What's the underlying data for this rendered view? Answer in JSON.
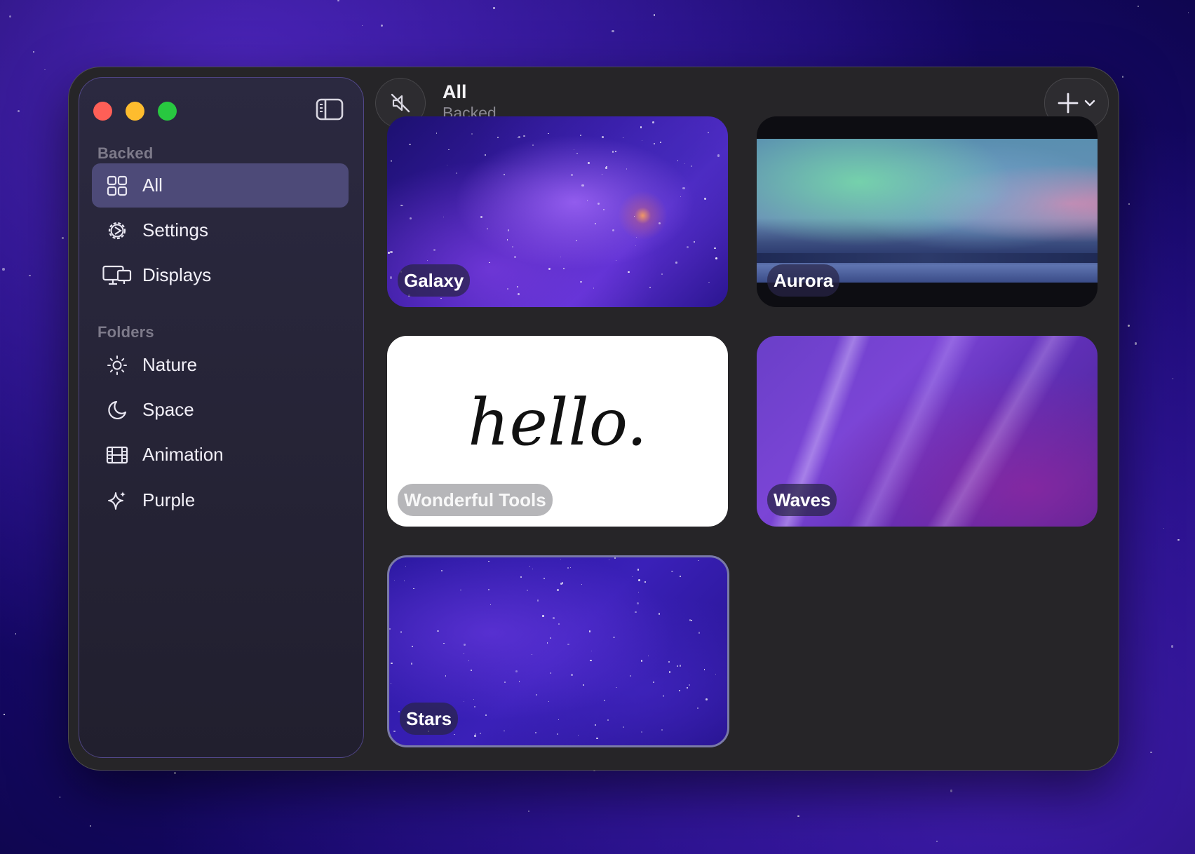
{
  "window": {
    "header": {
      "title": "All",
      "subtitle": "Backed"
    }
  },
  "sidebar": {
    "sections": [
      {
        "title": "Backed",
        "items": [
          {
            "label": "All",
            "icon": "grid-icon",
            "active": true
          },
          {
            "label": "Settings",
            "icon": "gear-icon",
            "active": false
          },
          {
            "label": "Displays",
            "icon": "displays-icon",
            "active": false
          }
        ]
      },
      {
        "title": "Folders",
        "items": [
          {
            "label": "Nature",
            "icon": "sun-icon",
            "active": false
          },
          {
            "label": "Space",
            "icon": "moon-icon",
            "active": false
          },
          {
            "label": "Animation",
            "icon": "film-icon",
            "active": false
          },
          {
            "label": "Purple",
            "icon": "sparkle-icon",
            "active": false
          }
        ]
      }
    ]
  },
  "wallpapers": [
    {
      "label": "Galaxy"
    },
    {
      "label": "Aurora"
    },
    {
      "label": "Wonderful Tools",
      "artwork_text": "hello."
    },
    {
      "label": "Waves"
    },
    {
      "label": "Stars",
      "selected": true
    }
  ],
  "colors": {
    "accent": "#4d4a78",
    "window_bg": "#262528",
    "selection_border": "#7a7aa8"
  }
}
